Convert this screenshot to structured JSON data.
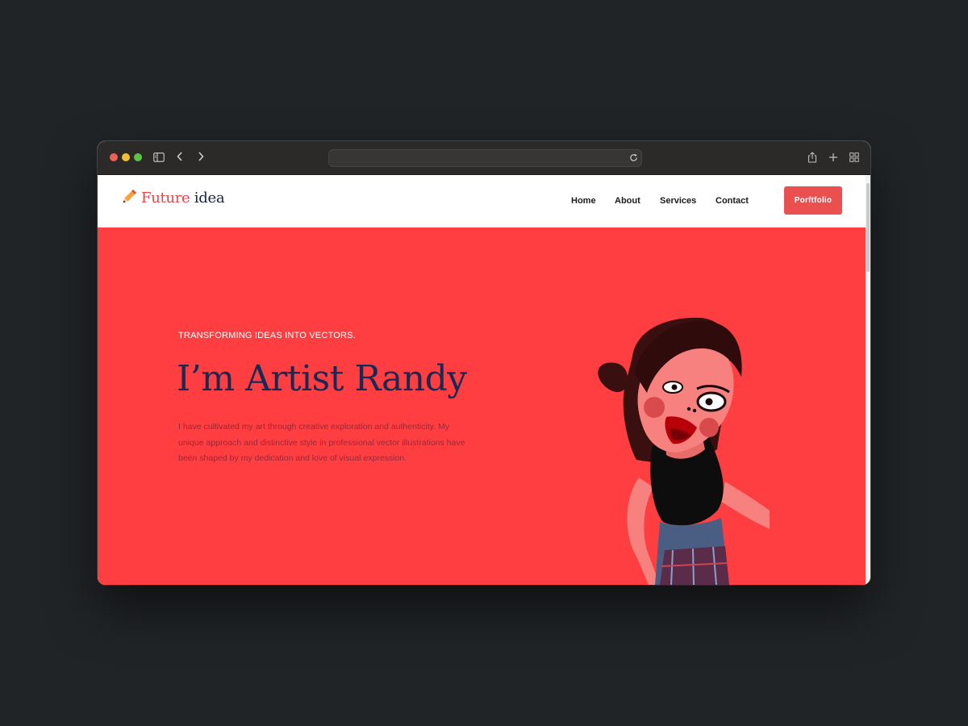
{
  "browser": {
    "icons": [
      "sidebar-icon",
      "back-icon",
      "forward-icon",
      "reload-icon",
      "share-icon",
      "new-tab-icon",
      "tab-overview-icon"
    ],
    "address_value": ""
  },
  "site": {
    "logo": {
      "part1": "Future",
      "part2": "idea",
      "icon": "pencil-icon"
    },
    "nav": [
      "Home",
      "About",
      "Services",
      "Contact"
    ],
    "cta_label": "Porftfolio"
  },
  "hero": {
    "eyebrow": "TRANSFORMING IDEAS INTO VECTORS.",
    "headline": "I’m Artist Randy",
    "bio": "I have cultivated my art through creative exploration and authenticity. My unique approach and distinctive style in professional vector illustrations have been shaped by my dedication and love of visual expression.",
    "illustration": "cartoon-woman-illustration"
  },
  "colors": {
    "hero_bg": "#fe3e41",
    "accent": "#e9504f",
    "headline": "#172a55",
    "page_bg": "#212427"
  }
}
